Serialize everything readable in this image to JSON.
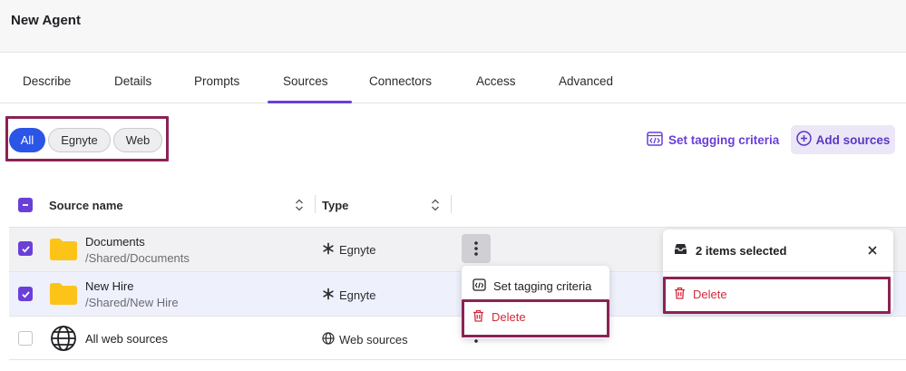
{
  "app": {
    "title": "New Agent"
  },
  "tabs": [
    {
      "label": "Describe"
    },
    {
      "label": "Details"
    },
    {
      "label": "Prompts"
    },
    {
      "label": "Sources",
      "active": true
    },
    {
      "label": "Connectors"
    },
    {
      "label": "Access"
    },
    {
      "label": "Advanced"
    }
  ],
  "filters": {
    "chips": [
      {
        "label": "All",
        "selected": true
      },
      {
        "label": "Egnyte",
        "selected": false
      },
      {
        "label": "Web",
        "selected": false
      }
    ]
  },
  "toolbar": {
    "tagging_label": "Set tagging criteria",
    "add_sources_label": "Add sources"
  },
  "table": {
    "columns": {
      "name": "Source name",
      "type": "Type"
    },
    "rows": [
      {
        "name": "Documents",
        "path": "/Shared/Documents",
        "type": "Egnyte",
        "checked": true,
        "icon": "folder-icon",
        "type_icon": "egnyte-icon"
      },
      {
        "name": "New Hire",
        "path": "/Shared/New Hire",
        "type": "Egnyte",
        "checked": true,
        "icon": "folder-icon",
        "type_icon": "egnyte-icon"
      },
      {
        "name": "All web sources",
        "path": "",
        "type": "Web sources",
        "checked": false,
        "icon": "globe-icon",
        "type_icon": "globe-icon"
      }
    ]
  },
  "context_menu": {
    "items": [
      {
        "label": "Set tagging criteria",
        "icon": "code-tag-icon"
      },
      {
        "label": "Delete",
        "icon": "trash-icon"
      }
    ]
  },
  "selection_panel": {
    "title": "2 items selected",
    "delete_label": "Delete"
  },
  "colors": {
    "accent": "#6a3fd8",
    "chip_selected": "#2a55e6",
    "danger": "#d42a3c",
    "highlight_outline": "#8b2255",
    "folder": "#fcc419"
  }
}
